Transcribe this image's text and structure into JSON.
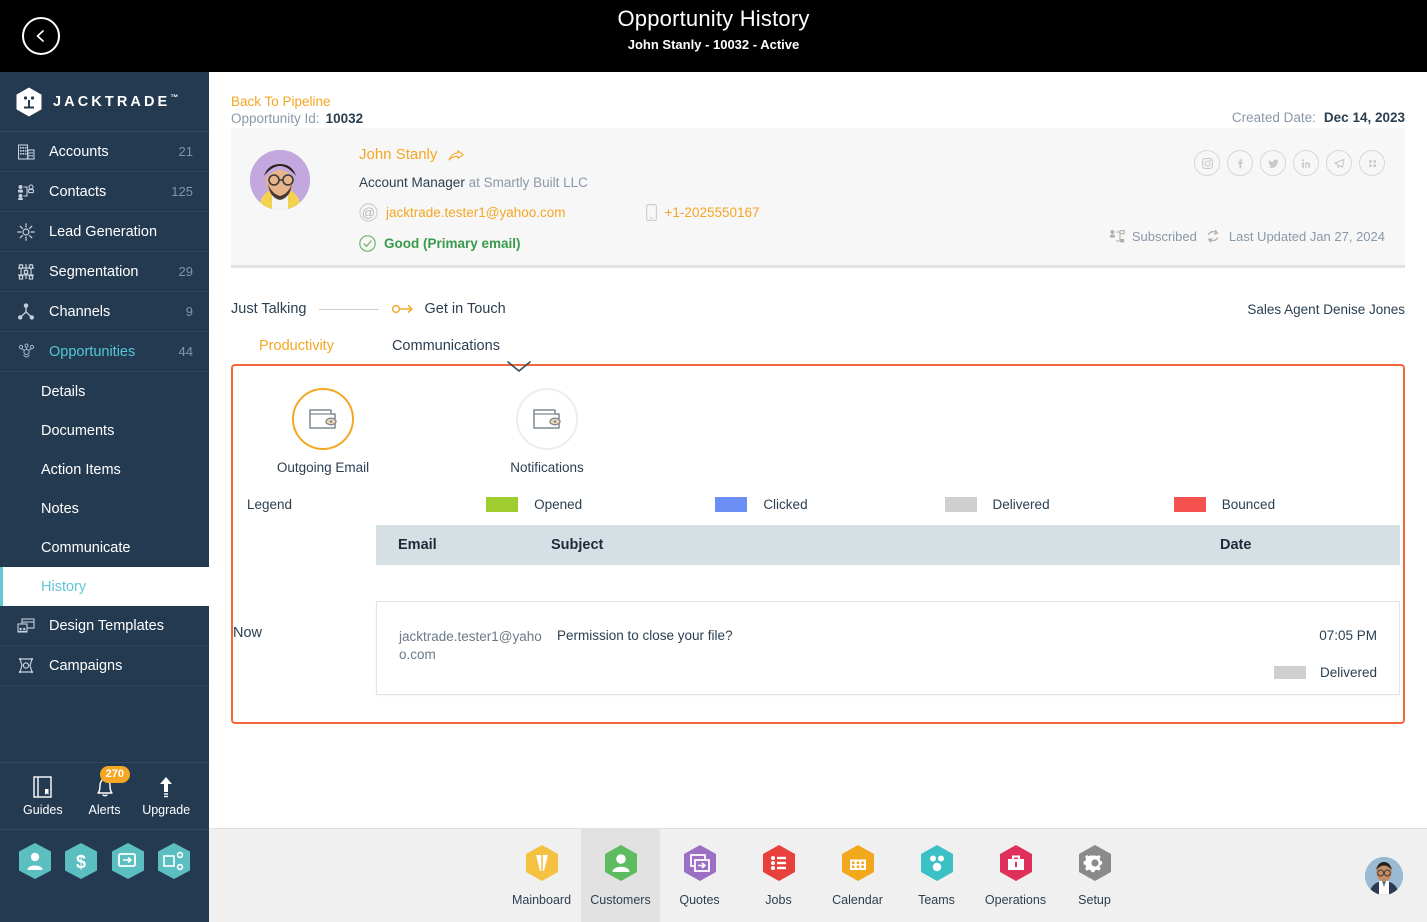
{
  "topbar": {
    "back_icon": "back-arrow-circle-icon",
    "title": "Opportunity History",
    "subtitle": "John Stanly - 10032 - Active"
  },
  "sidebar": {
    "brand": "JACKTRADE",
    "brand_tm": "™",
    "items": [
      {
        "label": "Accounts",
        "count": "21",
        "icon": "building-icon"
      },
      {
        "label": "Contacts",
        "count": "125",
        "icon": "contacts-icon"
      },
      {
        "label": "Lead Generation",
        "count": "",
        "icon": "lead-gen-icon"
      },
      {
        "label": "Segmentation",
        "count": "29",
        "icon": "segmentation-icon"
      },
      {
        "label": "Channels",
        "count": "9",
        "icon": "channels-icon"
      },
      {
        "label": "Opportunities",
        "count": "44",
        "icon": "opportunities-icon"
      }
    ],
    "sub_items": [
      {
        "label": "Details"
      },
      {
        "label": "Documents"
      },
      {
        "label": "Action Items"
      },
      {
        "label": "Notes"
      },
      {
        "label": "Communicate"
      },
      {
        "label": "History"
      }
    ],
    "bottom_items": [
      {
        "label": "Design Templates",
        "icon": "design-templates-icon"
      },
      {
        "label": "Campaigns",
        "icon": "campaigns-icon"
      }
    ],
    "tools": [
      {
        "label": "Guides",
        "icon": "book-icon",
        "badge": ""
      },
      {
        "label": "Alerts",
        "icon": "bell-icon",
        "badge": "270"
      },
      {
        "label": "Upgrade",
        "icon": "up-arrow-icon",
        "badge": ""
      }
    ],
    "shortcuts": [
      {
        "icon": "person-hex-icon"
      },
      {
        "icon": "dollar-hex-icon"
      },
      {
        "icon": "quote-hex-icon"
      },
      {
        "icon": "workflow-hex-icon"
      }
    ]
  },
  "breadcrumb": {
    "back_link": "Back To Pipeline",
    "id_label": "Opportunity Id:",
    "id_value": "10032",
    "created_label": "Created Date:",
    "created_value": "Dec 14, 2023"
  },
  "contact": {
    "name": "John Stanly",
    "role": "Account Manager",
    "company_prefix": "at Smartly Built LLC",
    "email": "jacktrade.tester1@yahoo.com",
    "phone": "+1-2025550167",
    "status": "Good (Primary email)",
    "subscribed": "Subscribed",
    "last_updated": "Last Updated Jan 27, 2024",
    "socials": [
      "instagram-icon",
      "facebook-icon",
      "twitter-icon",
      "linkedin-icon",
      "telegram-icon",
      "more-grid-icon"
    ]
  },
  "stage": {
    "from": "Just Talking",
    "to": "Get in Touch",
    "agent": "Sales Agent Denise Jones"
  },
  "tabs": [
    {
      "label": "Productivity",
      "active": true
    },
    {
      "label": "Communications",
      "active": false
    }
  ],
  "channels": [
    {
      "label": "Outgoing Email",
      "icon": "wallet-mail-icon",
      "selected": true
    },
    {
      "label": "Notifications",
      "icon": "wallet-mail-icon",
      "selected": false
    }
  ],
  "legend": {
    "title": "Legend",
    "items": [
      {
        "label": "Opened",
        "color": "#9fcc2e"
      },
      {
        "label": "Clicked",
        "color": "#6b8ef5"
      },
      {
        "label": "Delivered",
        "color": "#cfcfcf"
      },
      {
        "label": "Bounced",
        "color": "#f5524f"
      }
    ]
  },
  "table": {
    "columns": {
      "email": "Email",
      "subject": "Subject",
      "date": "Date"
    },
    "timeline_label": "Now",
    "rows": [
      {
        "email": "jacktrade.tester1@yahoo.com",
        "subject": "Permission to close your file?",
        "time": "07:05 PM",
        "status": "Delivered",
        "status_color": "#cfcfcf"
      }
    ]
  },
  "bottom_nav": [
    {
      "label": "Mainboard",
      "color": "#f5c141",
      "icon": "mainboard-icon",
      "selected": false
    },
    {
      "label": "Customers",
      "color": "#5fbb5f",
      "icon": "customers-icon",
      "selected": true
    },
    {
      "label": "Quotes",
      "color": "#9b6fc4",
      "icon": "quotes-icon",
      "selected": false
    },
    {
      "label": "Jobs",
      "color": "#e8403a",
      "icon": "jobs-icon",
      "selected": false
    },
    {
      "label": "Calendar",
      "color": "#f2a81d",
      "icon": "calendar-icon",
      "selected": false
    },
    {
      "label": "Teams",
      "color": "#3bc0c6",
      "icon": "teams-icon",
      "selected": false
    },
    {
      "label": "Operations",
      "color": "#e0305c",
      "icon": "operations-icon",
      "selected": false
    },
    {
      "label": "Setup",
      "color": "#8a8a8a",
      "icon": "setup-icon",
      "selected": false
    }
  ],
  "user_avatar": "user-avatar"
}
